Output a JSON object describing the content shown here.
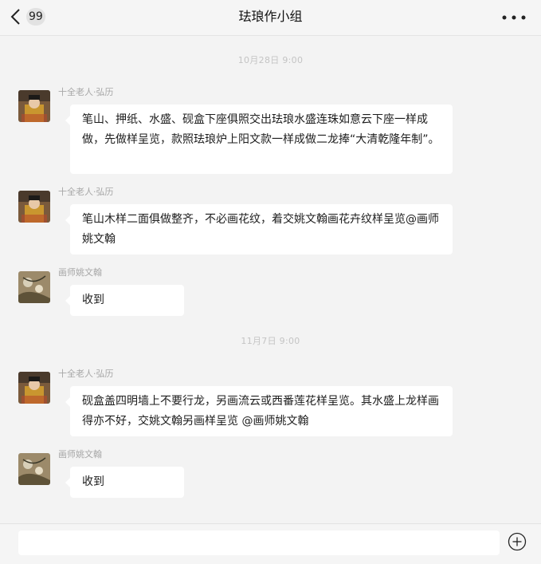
{
  "header": {
    "unread_count": "99",
    "title": "珐琅作小组"
  },
  "messages": [
    {
      "timestamp": "10月28日  9:00",
      "sender": "十全老人·弘历",
      "avatar": "emperor",
      "text": "笔山、押纸、水盛、砚盒下座俱照交出珐琅水盛连珠如意云下座一样成做，先做样呈览，款照珐琅炉上阳文款一样成做二龙捧“大清乾隆年制”。"
    },
    {
      "sender": "十全老人·弘历",
      "avatar": "emperor",
      "text": "笔山木样二面俱做整齐，不必画花纹，着交姚文翰画花卉纹样呈览@画师姚文翰"
    },
    {
      "sender": "画师姚文翰",
      "avatar": "painting",
      "text": "收到"
    },
    {
      "timestamp": "11月7日  9:00",
      "sender": "十全老人·弘历",
      "avatar": "emperor",
      "text": "砚盒盖四明墙上不要行龙，另画流云或西番莲花样呈览。其水盛上龙样画得亦不好，交姚文翰另画样呈览 @画师姚文翰"
    },
    {
      "sender": "画师姚文翰",
      "avatar": "painting",
      "text": "收到"
    }
  ],
  "footer": {
    "input_value": ""
  },
  "colors": {
    "background": "#f3f3f3",
    "bubble": "#ffffff",
    "sender_text": "#a6a6a6",
    "timestamp_text": "#c4c4c4"
  },
  "icons": {
    "back": "chevron-left-icon",
    "more": "more-dots-icon",
    "add": "plus-circle-icon"
  }
}
